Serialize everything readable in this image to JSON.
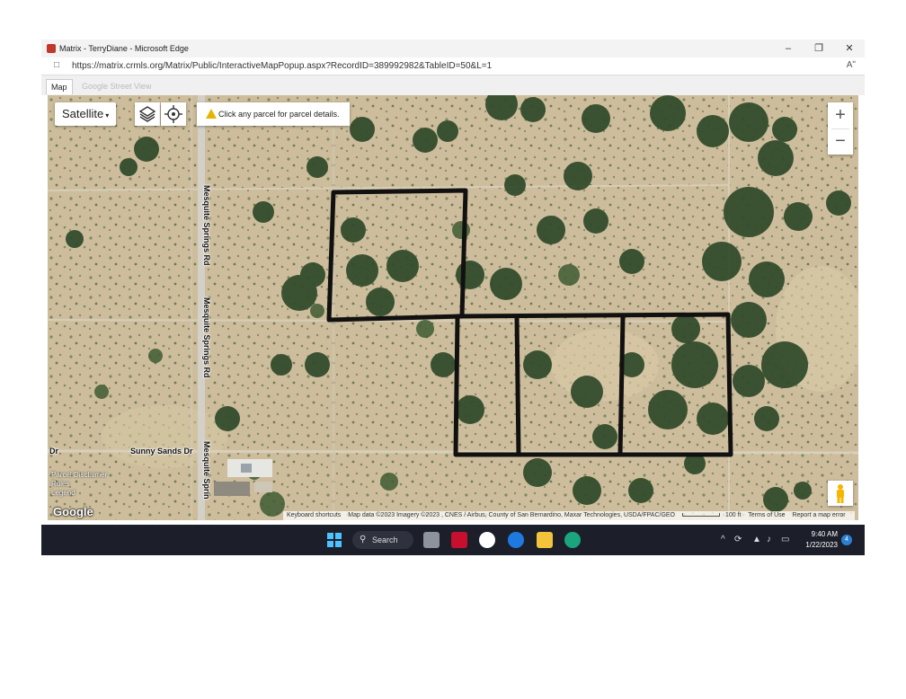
{
  "window": {
    "title": "Matrix - TerryDiane - Microsoft Edge",
    "minimize": "–",
    "restore": "❐",
    "close": "✕"
  },
  "address_bar": {
    "url": "https://matrix.crmls.org/Matrix/Public/InteractiveMapPopup.aspx?RecordID=389992982&TableID=50&L=1",
    "read_aloud": "Aʺ"
  },
  "tabs": [
    {
      "label": "Map",
      "active": true
    },
    {
      "label": "Google Street View",
      "active": false
    }
  ],
  "map": {
    "map_type_label": "Satellite",
    "notice": "Click any parcel for parcel details.",
    "zoom_in": "+",
    "zoom_out": "−",
    "roads": {
      "mesquite_north": "Mesquite Springs Rd",
      "mesquite_mid": "Mesquite Springs Rd",
      "mesquite_south": "Mesquite Sprin",
      "sunny_sands": "Sunny Sands Dr",
      "dr_left": "Dr"
    },
    "parcel_disclaimer": [
      "Parcel Disclaimer",
      "Rules",
      "Legend"
    ],
    "google_logo": "Google",
    "attribution": {
      "keyboard": "Keyboard shortcuts",
      "data": "Map data ©2023 Imagery ©2023 , CNES / Airbus, County of San Bernardino, Maxar Technologies, USDA/FPAC/GEO",
      "scale": "100 ft",
      "terms": "Terms of Use",
      "report": "Report a map error"
    },
    "outline_color": "#111111"
  },
  "taskbar": {
    "search_label": "Search",
    "time": "9:40 AM",
    "date": "1/22/2023",
    "notification_count": "4",
    "icons": [
      "windows-icon",
      "search-icon",
      "task-view-icon",
      "mcafee-icon",
      "github-icon",
      "help-icon",
      "file-explorer-icon",
      "edge-icon"
    ]
  }
}
